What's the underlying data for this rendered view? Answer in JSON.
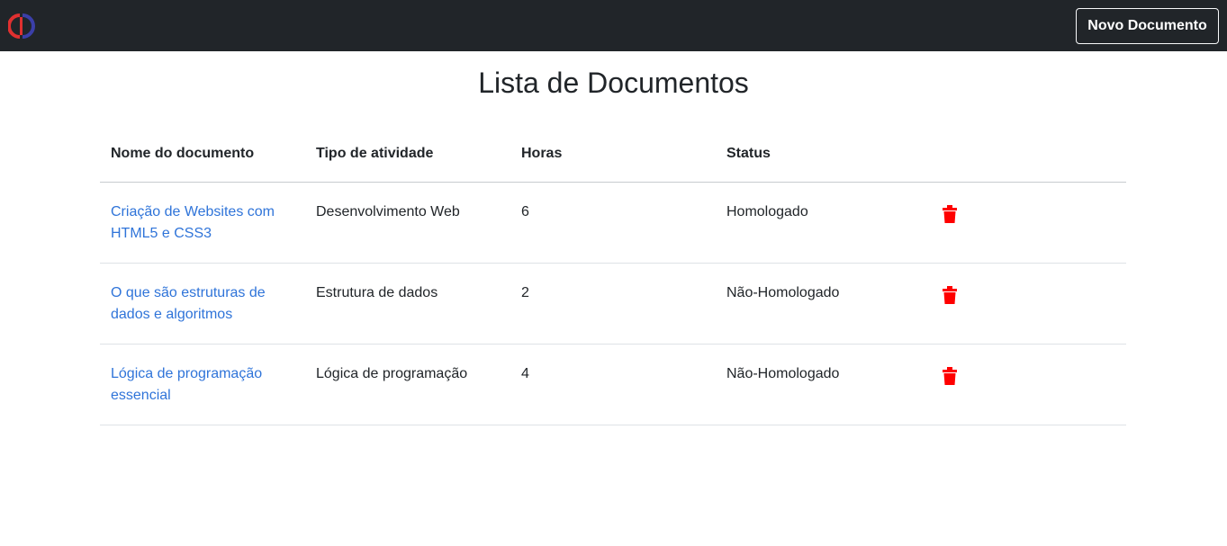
{
  "navbar": {
    "logo_icon": "circle-logo-icon",
    "new_document_label": "Novo Documento"
  },
  "page": {
    "title": "Lista de Documentos"
  },
  "table": {
    "headers": [
      "Nome do documento",
      "Tipo de atividade",
      "Horas",
      "Status",
      ""
    ],
    "rows": [
      {
        "name": "Criação de Websites com HTML5 e CSS3",
        "type": "Desenvolvimento Web",
        "hours": "6",
        "status": "Homologado",
        "delete_icon": "trash-icon"
      },
      {
        "name": "O que são estruturas de dados e algoritmos",
        "type": "Estrutura de dados",
        "hours": "2",
        "status": "Não-Homologado",
        "delete_icon": "trash-icon"
      },
      {
        "name": "Lógica de programação essencial",
        "type": "Lógica de programação",
        "hours": "4",
        "status": "Não-Homologado",
        "delete_icon": "trash-icon"
      }
    ]
  },
  "colors": {
    "navbar_bg": "#212529",
    "link": "#2f74d9",
    "delete": "#ff0000",
    "logo_red": "#e03030",
    "logo_blue": "#3b3fa8"
  }
}
